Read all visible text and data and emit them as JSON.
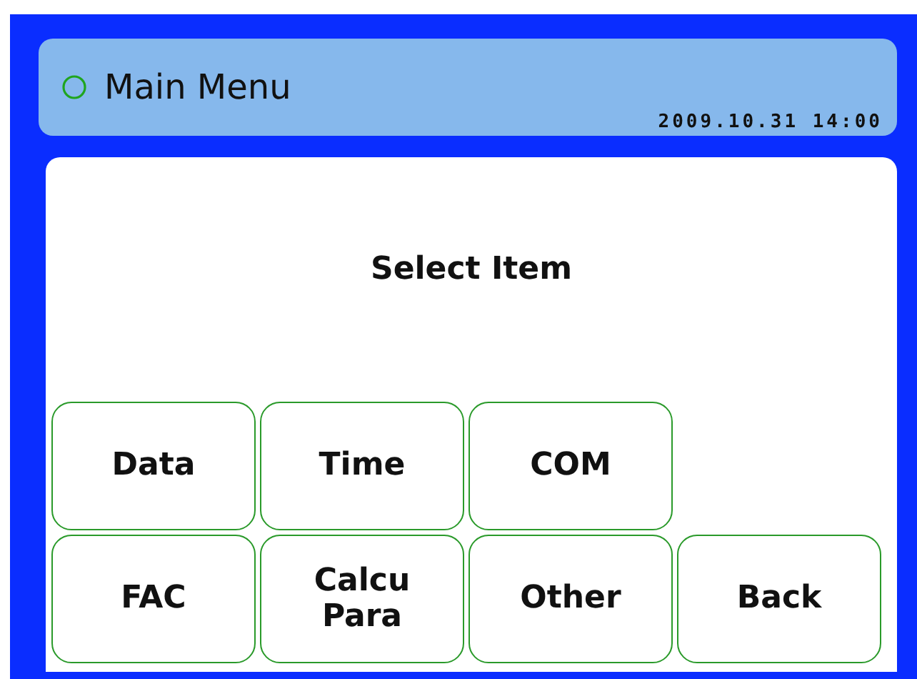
{
  "header": {
    "title": "Main Menu",
    "datetime": "2009.10.31 14:00"
  },
  "prompt": "Select Item",
  "button_rows": [
    [
      "Data",
      "Time",
      "COM"
    ],
    [
      "FAC",
      "Calcu\nPara",
      "Other",
      "Back"
    ]
  ]
}
